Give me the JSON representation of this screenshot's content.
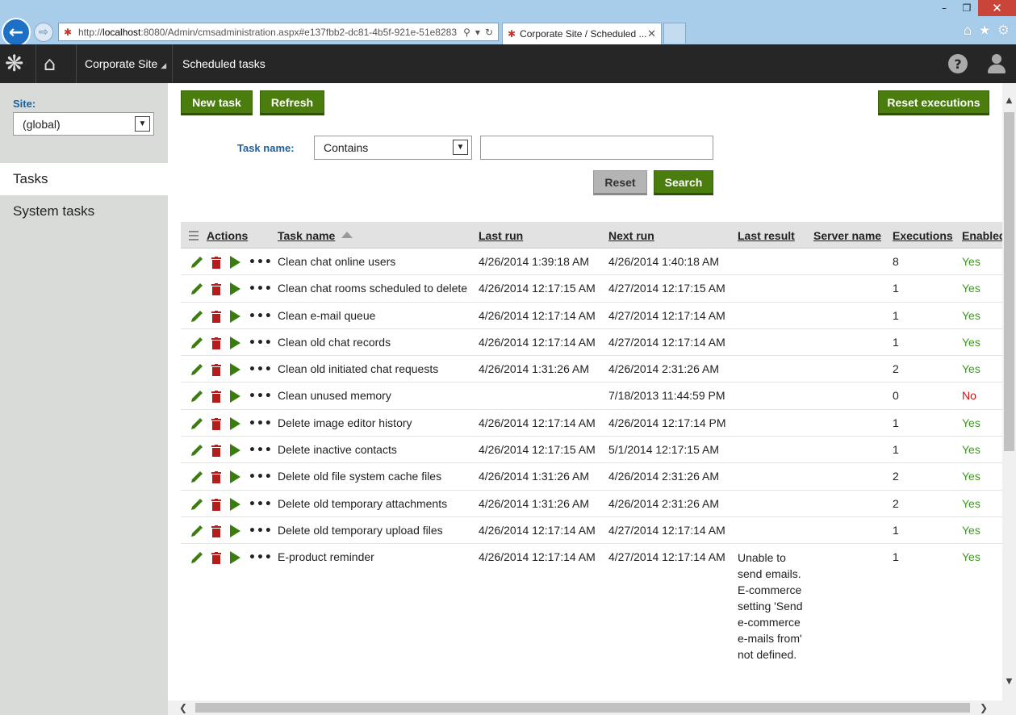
{
  "browser": {
    "url_prefix": "http://",
    "url_host": "localhost",
    "url_rest": ":8080/Admin/cmsadministration.aspx#e137fbb2-dc81-4b5f-921e-51e8283",
    "tab_title": "Corporate Site / Scheduled ...",
    "tab_close": "✕",
    "minimize": "–",
    "restore": "❐",
    "close": "✕"
  },
  "appbar": {
    "site_name": "Corporate Site",
    "app_name": "Scheduled tasks",
    "help": "?"
  },
  "left": {
    "site_label": "Site:",
    "site_value": "(global)",
    "nav": [
      "Tasks",
      "System tasks"
    ]
  },
  "toolbar": {
    "new_task": "New task",
    "refresh": "Refresh",
    "reset_executions": "Reset executions"
  },
  "filter": {
    "label": "Task name:",
    "operator": "Contains",
    "value": "",
    "reset": "Reset",
    "search": "Search"
  },
  "grid": {
    "headers": {
      "actions": "Actions",
      "task_name": "Task name",
      "last_run": "Last run",
      "next_run": "Next run",
      "last_result": "Last result",
      "server_name": "Server name",
      "executions": "Executions",
      "enabled": "Enabled"
    },
    "more_glyph": "•••",
    "rows": [
      {
        "name": "Clean chat online users",
        "last_run": "4/26/2014 1:39:18 AM",
        "next_run": "4/26/2014 1:40:18 AM",
        "last_result": "",
        "server": "",
        "executions": "8",
        "enabled": "Yes"
      },
      {
        "name": "Clean chat rooms scheduled to delete",
        "last_run": "4/26/2014 12:17:15 AM",
        "next_run": "4/27/2014 12:17:15 AM",
        "last_result": "",
        "server": "",
        "executions": "1",
        "enabled": "Yes"
      },
      {
        "name": "Clean e-mail queue",
        "last_run": "4/26/2014 12:17:14 AM",
        "next_run": "4/27/2014 12:17:14 AM",
        "last_result": "",
        "server": "",
        "executions": "1",
        "enabled": "Yes"
      },
      {
        "name": "Clean old chat records",
        "last_run": "4/26/2014 12:17:14 AM",
        "next_run": "4/27/2014 12:17:14 AM",
        "last_result": "",
        "server": "",
        "executions": "1",
        "enabled": "Yes"
      },
      {
        "name": "Clean old initiated chat requests",
        "last_run": "4/26/2014 1:31:26 AM",
        "next_run": "4/26/2014 2:31:26 AM",
        "last_result": "",
        "server": "",
        "executions": "2",
        "enabled": "Yes"
      },
      {
        "name": "Clean unused memory",
        "last_run": "",
        "next_run": "7/18/2013 11:44:59 PM",
        "last_result": "",
        "server": "",
        "executions": "0",
        "enabled": "No"
      },
      {
        "name": "Delete image editor history",
        "last_run": "4/26/2014 12:17:14 AM",
        "next_run": "4/26/2014 12:17:14 PM",
        "last_result": "",
        "server": "",
        "executions": "1",
        "enabled": "Yes"
      },
      {
        "name": "Delete inactive contacts",
        "last_run": "4/26/2014 12:17:15 AM",
        "next_run": "5/1/2014 12:17:15 AM",
        "last_result": "",
        "server": "",
        "executions": "1",
        "enabled": "Yes"
      },
      {
        "name": "Delete old file system cache files",
        "last_run": "4/26/2014 1:31:26 AM",
        "next_run": "4/26/2014 2:31:26 AM",
        "last_result": "",
        "server": "",
        "executions": "2",
        "enabled": "Yes"
      },
      {
        "name": "Delete old temporary attachments",
        "last_run": "4/26/2014 1:31:26 AM",
        "next_run": "4/26/2014 2:31:26 AM",
        "last_result": "",
        "server": "",
        "executions": "2",
        "enabled": "Yes"
      },
      {
        "name": "Delete old temporary upload files",
        "last_run": "4/26/2014 12:17:14 AM",
        "next_run": "4/27/2014 12:17:14 AM",
        "last_result": "",
        "server": "",
        "executions": "1",
        "enabled": "Yes"
      },
      {
        "name": "E-product reminder",
        "last_run": "4/26/2014 12:17:14 AM",
        "next_run": "4/27/2014 12:17:14 AM",
        "last_result": "Unable to send emails. E-commerce setting 'Send e-commerce e-mails from' not defined.",
        "server": "",
        "executions": "1",
        "enabled": "Yes"
      }
    ]
  },
  "colors": {
    "accent_green": "#4a7d0e",
    "link_blue": "#1f5f99",
    "yes": "#3a9a18",
    "no": "#cc1111",
    "delete_red": "#b51c1c",
    "header_dark": "#262626"
  }
}
